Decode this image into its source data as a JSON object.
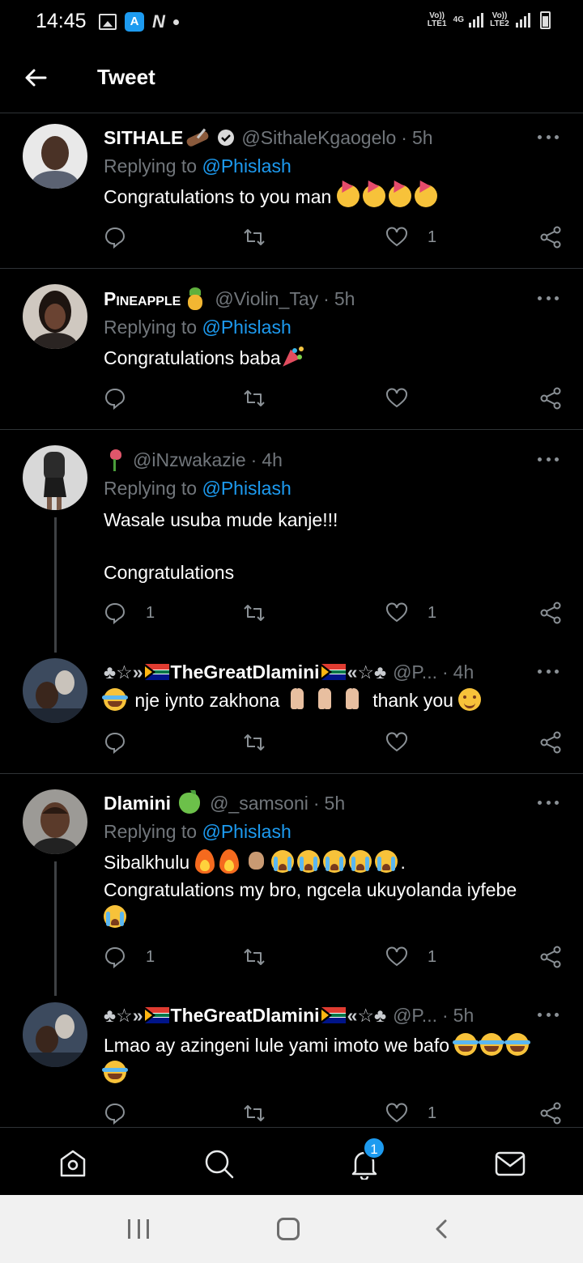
{
  "status_bar": {
    "time": "14:45",
    "sim1_label": "Vo)) LTE1",
    "network": "4G",
    "sim2_label": "Vo)) LTE2",
    "app_icon_letter": "A",
    "notif_letter": "N"
  },
  "header": {
    "title": "Tweet"
  },
  "replying_prefix": "Replying to ",
  "tweets": [
    {
      "name": "SITHALE",
      "handle": "@SithaleKgaogelo",
      "time": "5h",
      "replying_to": "@Phislash",
      "text": "Congratulations to you man",
      "reply_count": "",
      "retweet_count": "",
      "like_count": "1"
    },
    {
      "name": "Pineapple",
      "handle": "@Violin_Tay",
      "time": "5h",
      "replying_to": "@Phislash",
      "text": "Congratulations baba",
      "reply_count": "",
      "retweet_count": "",
      "like_count": ""
    },
    {
      "name": "",
      "handle": "@iNzwakazie",
      "time": "4h",
      "replying_to": "@Phislash",
      "text_line1": "Wasale usuba mude kanje!!!",
      "text_line2": "Congratulations",
      "reply_count": "1",
      "retweet_count": "",
      "like_count": "1"
    },
    {
      "name_prefix": "♣☆»",
      "name": "TheGreatDlamini",
      "name_suffix": "«☆♣",
      "handle": "@P...",
      "time": "4h",
      "text_a": "nje iynto zakhona",
      "text_b": "thank you",
      "reply_count": "",
      "retweet_count": "",
      "like_count": ""
    },
    {
      "name": "Dlamini",
      "handle": "@_samsoni",
      "time": "5h",
      "replying_to": "@Phislash",
      "text_line1": "Sibalkhulu",
      "text_line2": "Congratulations my bro, ngcela ukuyolanda iyfebe",
      "reply_count": "1",
      "retweet_count": "",
      "like_count": "1"
    },
    {
      "name_prefix": "♣☆»",
      "name": "TheGreatDlamini",
      "name_suffix": "«☆♣",
      "handle": "@P...",
      "time": "5h",
      "text": "Lmao ay azingeni lule yami imoto we bafo",
      "reply_count": "",
      "retweet_count": "",
      "like_count": "1"
    }
  ],
  "bottom_nav": {
    "items": [
      "home-icon",
      "search-icon",
      "notifications-icon",
      "messages-icon"
    ],
    "notification_badge": "1"
  },
  "colors": {
    "background": "#000000",
    "accent": "#1d9bf0",
    "secondary_text": "#71767b",
    "divider": "#2f3336"
  }
}
